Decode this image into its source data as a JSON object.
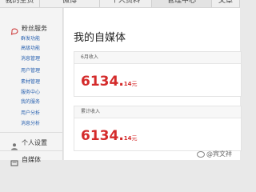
{
  "nav": {
    "tabs": [
      {
        "label": "我的主页"
      },
      {
        "label": "微博"
      },
      {
        "label": "个人资料"
      },
      {
        "label": "管理中心"
      },
      {
        "label": "文章"
      }
    ]
  },
  "sidebar": {
    "section_fans": "粉丝服务",
    "items": [
      {
        "label": "群发功能"
      },
      {
        "label": "高级功能"
      },
      {
        "label": "消息管理"
      },
      {
        "label": "用户管理"
      },
      {
        "label": "素材管理"
      },
      {
        "label": "服务中心"
      },
      {
        "label": "我的服务"
      },
      {
        "label": "用户分析"
      },
      {
        "label": "消息分析"
      }
    ],
    "section_personal": "个人设置",
    "section_media": "自媒体"
  },
  "main": {
    "title": "我的自媒体",
    "cards": [
      {
        "label": "6月收入",
        "amount_int": "6134.",
        "amount_dec": "14",
        "unit": "元"
      },
      {
        "label": "累计收入",
        "amount_int": "6134.",
        "amount_dec": "14",
        "unit": "元"
      }
    ]
  },
  "watermark": {
    "text": "@宾文祥"
  }
}
